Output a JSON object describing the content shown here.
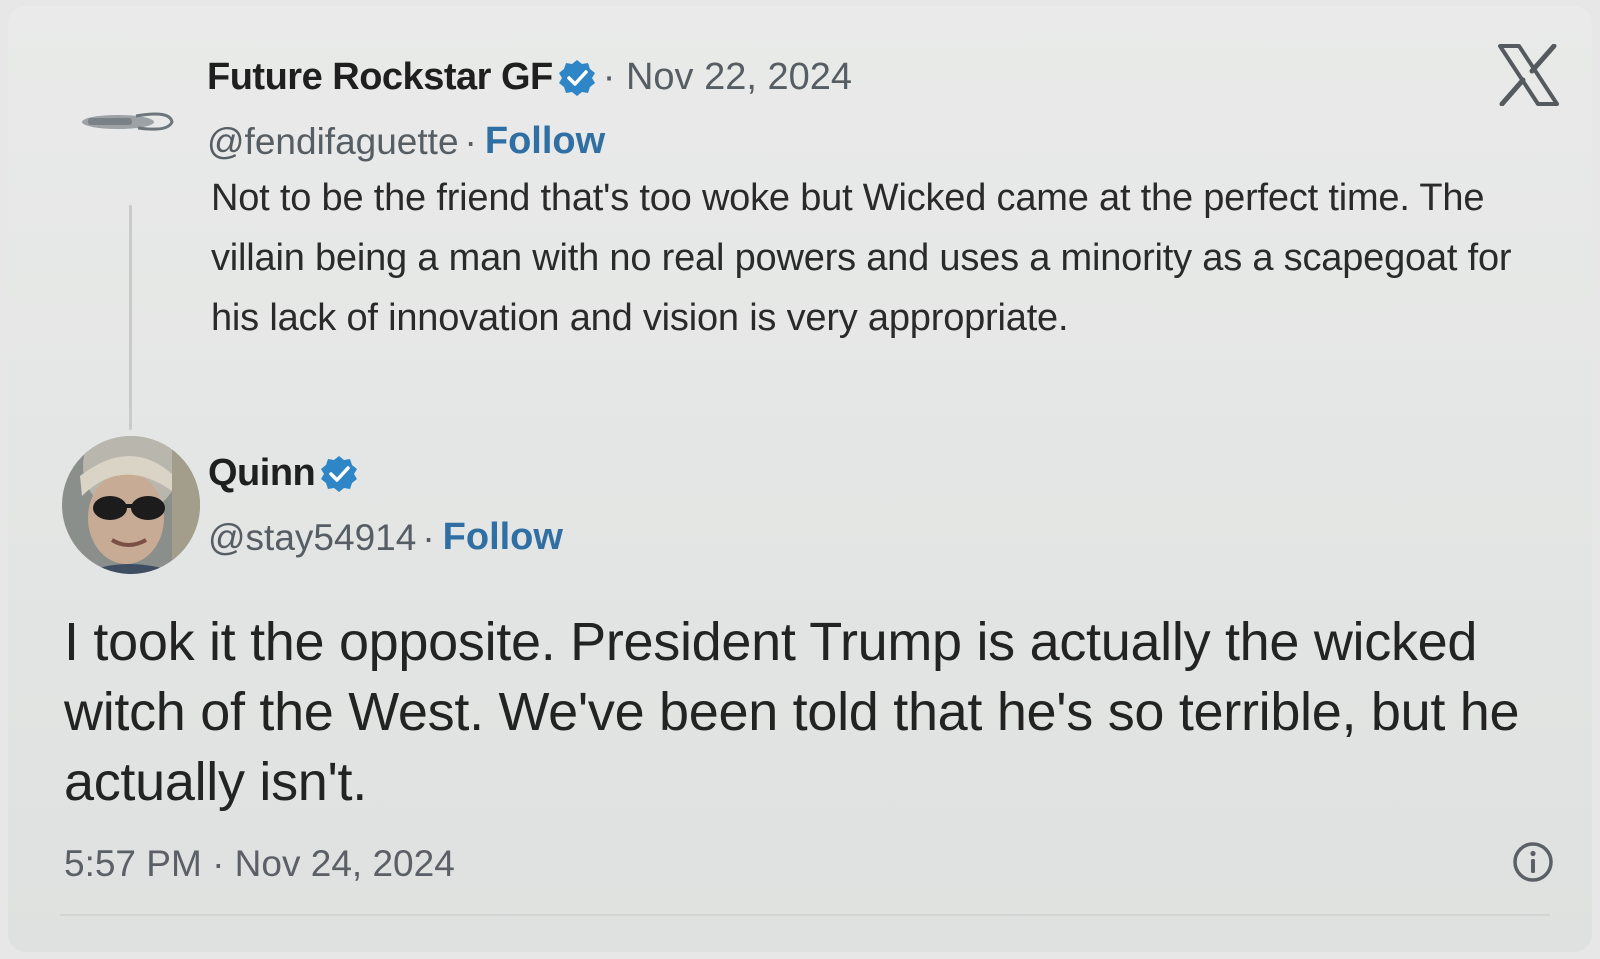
{
  "quoted_tweet": {
    "display_name": "Future Rockstar GF",
    "date": "· Nov 22, 2024",
    "handle": "@fendifaguette",
    "separator": "·",
    "follow_label": "Follow",
    "text": "Not to be the friend that's too woke but Wicked came at the perfect time. The villain being a man with no real powers and uses a minority as a scapegoat for his lack of innovation and vision is very appropriate."
  },
  "reply_tweet": {
    "display_name": "Quinn",
    "handle": "@stay54914",
    "separator": "·",
    "follow_label": "Follow",
    "text": "I took it the opposite. President Trump is actually the wicked witch of the West. We've been told that he's so terrible, but he actually isn't.",
    "timestamp": "5:57 PM · Nov 24, 2024"
  },
  "icons": {
    "brand": "x-logo-icon",
    "verified": "verified-badge-icon",
    "info": "info-icon"
  },
  "colors": {
    "verified": "#2f86c6",
    "follow": "#2f6fa3",
    "muted_text": "#565d63",
    "background": "#e6e7e6"
  }
}
